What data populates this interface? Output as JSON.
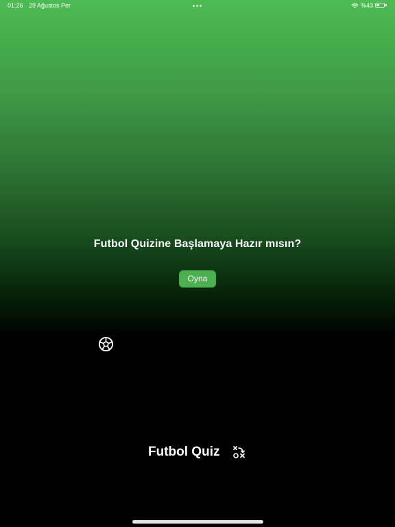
{
  "status_bar": {
    "time": "01:26",
    "date": "29 Ağustos Per",
    "battery_text": "%43",
    "battery_level": 0.43,
    "icons": [
      "wifi-icon",
      "battery-icon"
    ]
  },
  "main": {
    "question": "Futbol Quizine Başlamaya Hazır mısın?",
    "play_label": "Oyna",
    "ball_icon": "soccer-ball-icon"
  },
  "footer": {
    "title": "Futbol Quiz",
    "icon": "tactics-icon"
  },
  "colors": {
    "gradient_top": "#4dbb53",
    "gradient_bottom": "#000000",
    "button": "#4caf50",
    "text": "#ffffff"
  }
}
